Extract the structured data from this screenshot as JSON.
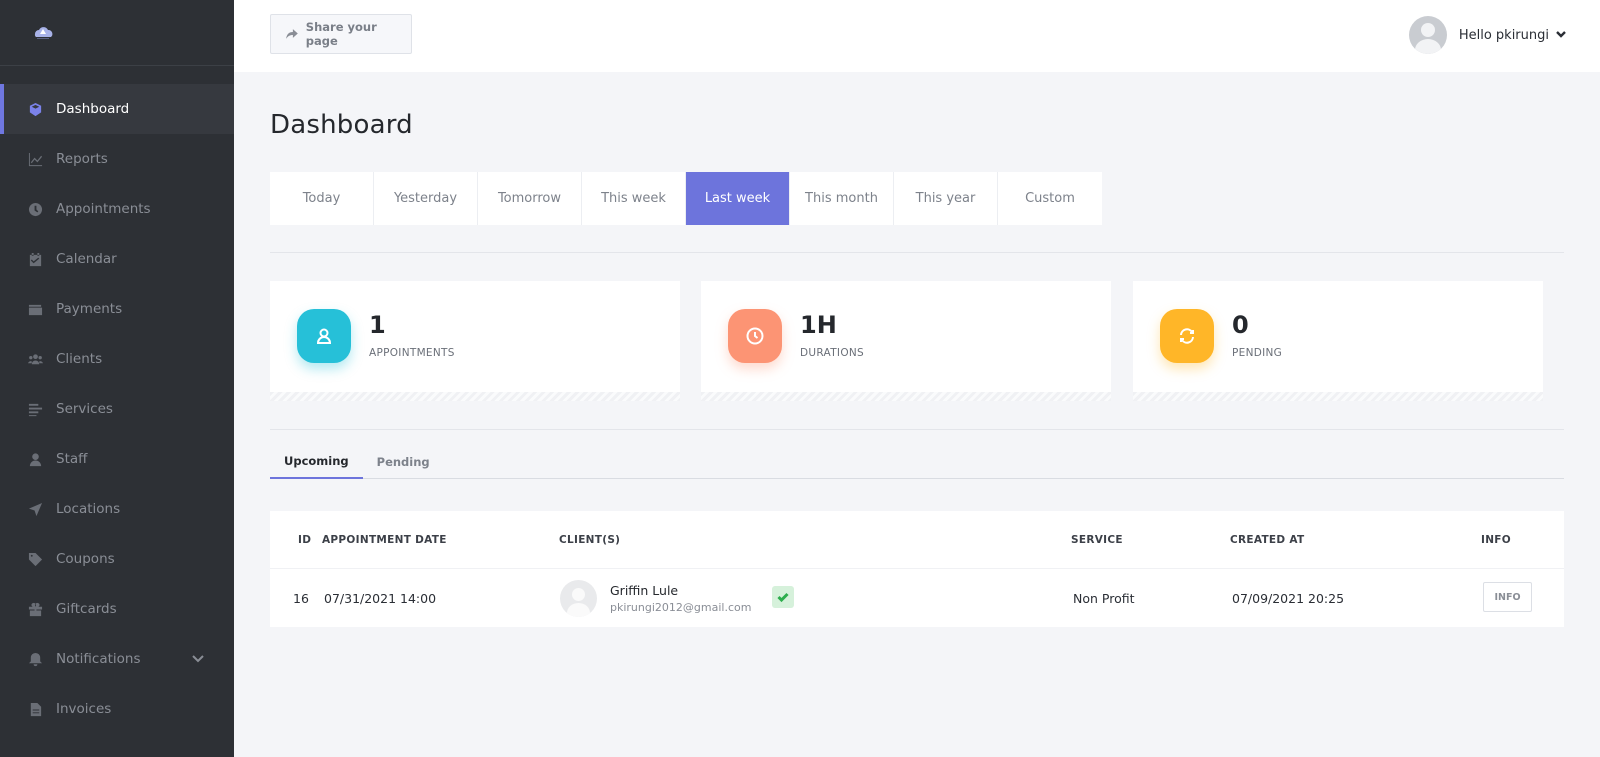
{
  "sidebar": {
    "items": [
      {
        "label": "Dashboard",
        "icon": "cube-icon",
        "active": true
      },
      {
        "label": "Reports",
        "icon": "chart-icon"
      },
      {
        "label": "Appointments",
        "icon": "clock-icon"
      },
      {
        "label": "Calendar",
        "icon": "calendar-icon"
      },
      {
        "label": "Payments",
        "icon": "wallet-icon"
      },
      {
        "label": "Clients",
        "icon": "users-icon"
      },
      {
        "label": "Services",
        "icon": "list-icon"
      },
      {
        "label": "Staff",
        "icon": "user-icon"
      },
      {
        "label": "Locations",
        "icon": "location-arrow-icon"
      },
      {
        "label": "Coupons",
        "icon": "tag-icon"
      },
      {
        "label": "Giftcards",
        "icon": "gift-icon"
      },
      {
        "label": "Notifications",
        "icon": "bell-icon",
        "expandable": true
      },
      {
        "label": "Invoices",
        "icon": "file-icon"
      }
    ]
  },
  "topbar": {
    "share_label": "Share your page",
    "user_greeting": "Hello pkirungi"
  },
  "page": {
    "title": "Dashboard"
  },
  "range_tabs": [
    "Today",
    "Yesterday",
    "Tomorrow",
    "This week",
    "Last week",
    "This month",
    "This year",
    "Custom"
  ],
  "range_active": "Last week",
  "stats": [
    {
      "value": "1",
      "label": "APPOINTMENTS",
      "color": "#26c0d8",
      "icon": "user-icon"
    },
    {
      "value": "1H",
      "label": "DURATIONS",
      "color": "#fc9474",
      "icon": "clock-icon"
    },
    {
      "value": "0",
      "label": "PENDING",
      "color": "#ffb628",
      "icon": "refresh-icon"
    }
  ],
  "sub_tabs": [
    "Upcoming",
    "Pending"
  ],
  "table": {
    "headers": {
      "id": "ID",
      "date": "APPOINTMENT DATE",
      "clients": "CLIENT(S)",
      "service": "SERVICE",
      "created": "CREATED AT",
      "info": "INFO"
    },
    "rows": [
      {
        "id": "16",
        "date": "07/31/2021 14:00",
        "client_name": "Griffin Lule",
        "client_email": "pkirungi2012@gmail.com",
        "service": "Non Profit",
        "created": "07/09/2021 20:25",
        "info_label": "INFO"
      }
    ]
  },
  "colors": {
    "accent": "#6d74dc",
    "sidebar_bg": "#2d3035"
  }
}
